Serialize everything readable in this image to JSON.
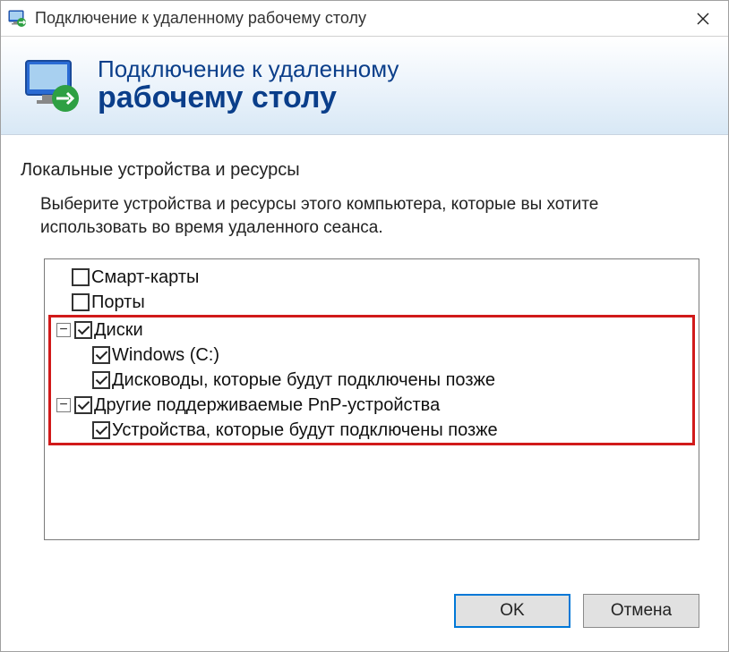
{
  "window": {
    "title": "Подключение к удаленному рабочему столу"
  },
  "banner": {
    "line1": "Подключение к удаленному",
    "line2": "рабочему столу"
  },
  "section": {
    "title": "Локальные устройства и ресурсы",
    "description": "Выберите устройства и ресурсы этого компьютера, которые вы хотите использовать во время удаленного сеанса."
  },
  "tree": {
    "items": [
      {
        "label": "Смарт-карты",
        "checked": false,
        "level": 0,
        "expander": null,
        "highlight": false
      },
      {
        "label": "Порты",
        "checked": false,
        "level": 0,
        "expander": null,
        "highlight": false
      },
      {
        "label": "Диски",
        "checked": true,
        "level": 0,
        "expander": "minus",
        "highlight": true
      },
      {
        "label": "Windows (C:)",
        "checked": true,
        "level": 2,
        "expander": null,
        "highlight": true
      },
      {
        "label": "Дисководы, которые будут подключены позже",
        "checked": true,
        "level": 2,
        "expander": null,
        "highlight": true
      },
      {
        "label": "Другие поддерживаемые PnP-устройства",
        "checked": true,
        "level": 0,
        "expander": "minus",
        "highlight": true
      },
      {
        "label": "Устройства, которые будут подключены позже",
        "checked": true,
        "level": 2,
        "expander": null,
        "highlight": true
      }
    ]
  },
  "buttons": {
    "ok": "OK",
    "cancel": "Отмена"
  },
  "expander_glyph": {
    "minus": "−",
    "plus": "+"
  }
}
